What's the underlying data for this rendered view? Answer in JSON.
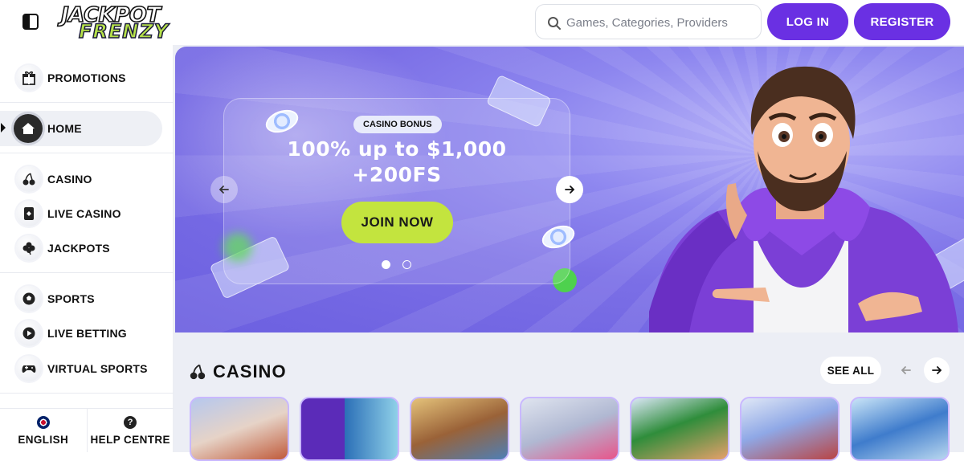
{
  "header": {
    "logo_line1": "JACKPOT",
    "logo_line2": "FRENZY",
    "search_placeholder": "Games, Categories, Providers",
    "login_label": "LOG IN",
    "register_label": "REGISTER",
    "accent_color": "#6a30e3"
  },
  "sidebar": {
    "items": [
      {
        "label": "PROMOTIONS",
        "icon": "gift-icon"
      },
      {
        "label": "HOME",
        "icon": "home-icon",
        "active": true
      },
      {
        "label": "CASINO",
        "icon": "cherries-icon"
      },
      {
        "label": "LIVE CASINO",
        "icon": "playing-card-icon"
      },
      {
        "label": "JACKPOTS",
        "icon": "clover-icon"
      },
      {
        "label": "SPORTS",
        "icon": "soccer-ball-icon"
      },
      {
        "label": "LIVE BETTING",
        "icon": "play-icon"
      },
      {
        "label": "VIRTUAL SPORTS",
        "icon": "gamepad-icon"
      }
    ],
    "footer": {
      "language_label": "ENGLISH",
      "help_label": "HELP CENTRE"
    }
  },
  "hero": {
    "tag": "CASINO BONUS",
    "headline_line1": "100% up to $1,000",
    "headline_line2": "+200FS",
    "cta_label": "JOIN NOW",
    "slides_total": 2,
    "active_slide": 1,
    "cta_color": "#c3e43e"
  },
  "casino_section": {
    "title": "CASINO",
    "see_all_label": "SEE ALL",
    "tiles": [
      {
        "art": "viking-game"
      },
      {
        "art": "slot-machine-game"
      },
      {
        "art": "greek-god-game"
      },
      {
        "art": "crown-game"
      },
      {
        "art": "leprechaun-game"
      },
      {
        "art": "roulette-game"
      },
      {
        "art": "retro-slot-game"
      }
    ]
  }
}
